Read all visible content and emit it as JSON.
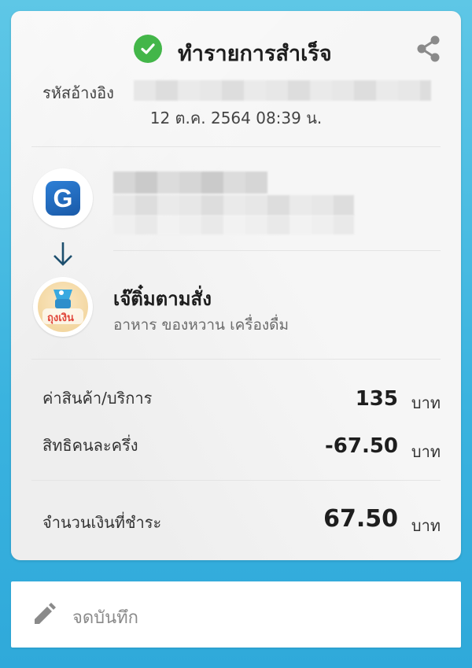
{
  "header": {
    "title": "ทำรายการสำเร็จ",
    "status_icon": "check-circle-icon",
    "share_icon": "share-icon",
    "success_color": "#43b649"
  },
  "reference": {
    "label": "รหัสอ้างอิง",
    "date": "12 ต.ค. 2564 08:39 น."
  },
  "sender": {
    "icon": "g-wallet-icon"
  },
  "transfer_icon": "arrow-down-icon",
  "merchant": {
    "name": "เจ๊ติ๋มตามสั่ง",
    "category": "อาหาร ของหวาน เครื่องดื่ม",
    "logo_text": "ถุงเงิน"
  },
  "summary": {
    "rows": [
      {
        "label": "ค่าสินค้า/บริการ",
        "value": "135",
        "unit": "บาท"
      },
      {
        "label": "สิทธิคนละครึ่ง",
        "value": "-67.50",
        "unit": "บาท"
      }
    ],
    "total": {
      "label": "จำนวนเงินที่ชำระ",
      "value": "67.50",
      "unit": "บาท"
    }
  },
  "note": {
    "placeholder": "จดบันทึก",
    "icon": "pencil-icon"
  }
}
